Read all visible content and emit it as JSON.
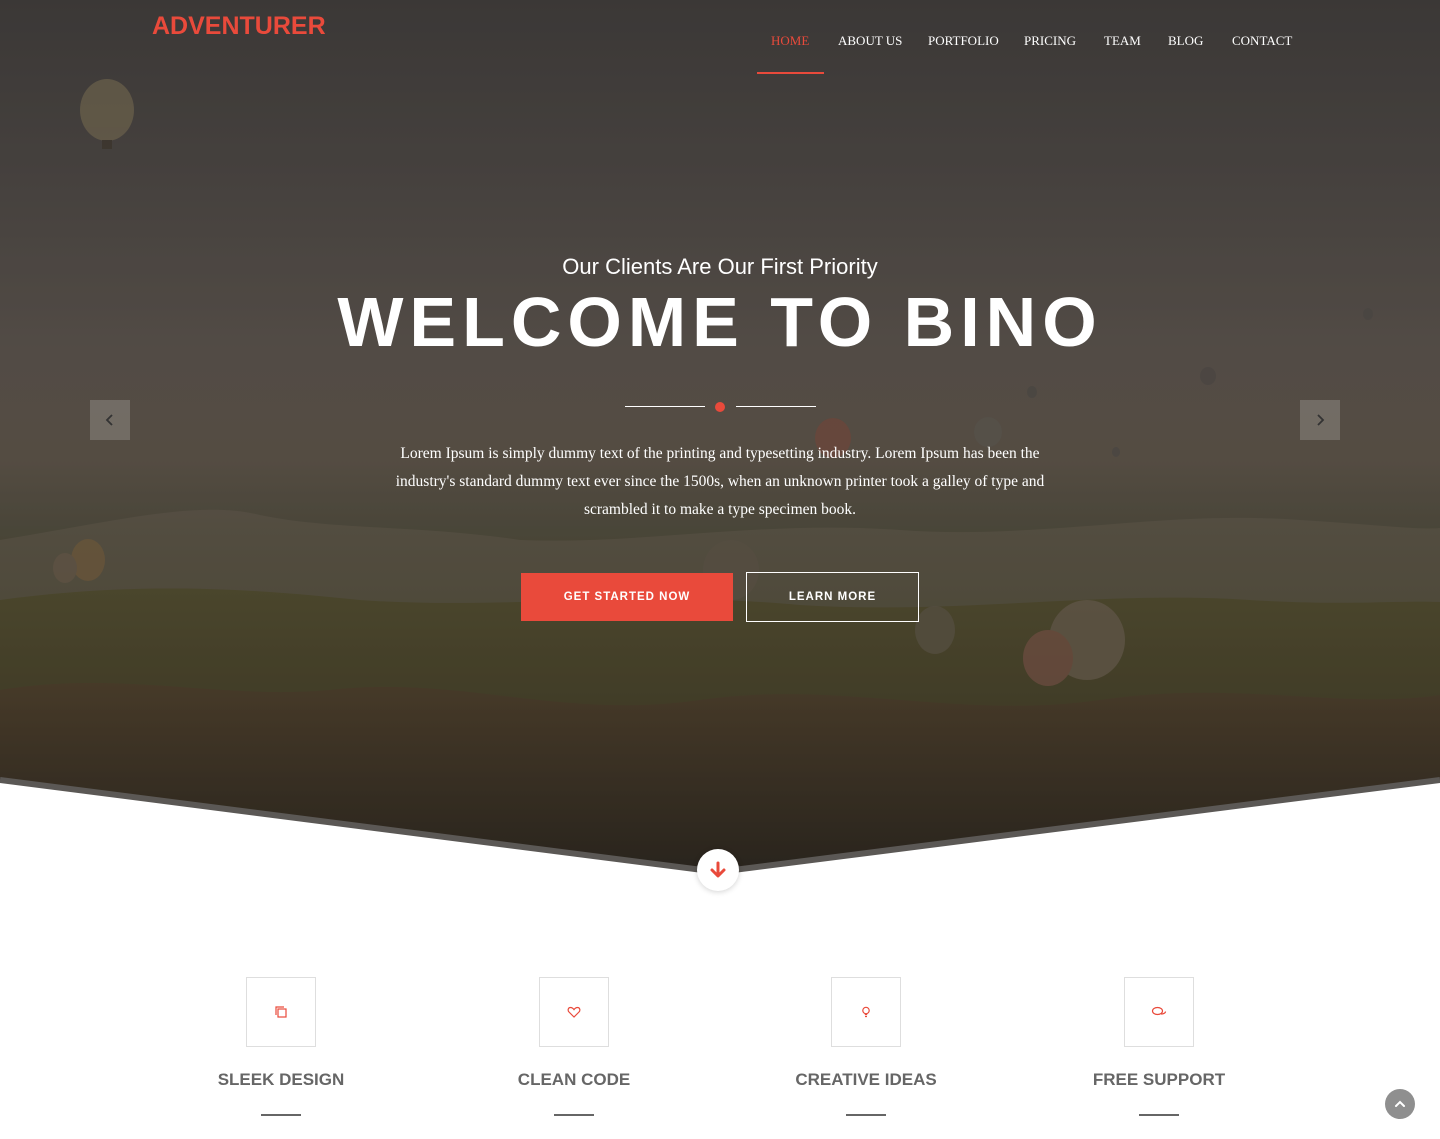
{
  "brand": {
    "logo_text": "ADVENTURER",
    "accent_color": "#e94a3b"
  },
  "nav": {
    "items": [
      {
        "label": "HOME",
        "active": true
      },
      {
        "label": "ABOUT US",
        "active": false
      },
      {
        "label": "PORTFOLIO",
        "active": false
      },
      {
        "label": "PRICING",
        "active": false
      },
      {
        "label": "TEAM",
        "active": false
      },
      {
        "label": "BLOG",
        "active": false
      },
      {
        "label": "CONTACT",
        "active": false
      }
    ]
  },
  "hero": {
    "subtitle": "Our Clients Are Our First Priority",
    "title": "WELCOME TO BINO",
    "description": "Lorem Ipsum is simply dummy text of the printing and typesetting industry. Lorem Ipsum has been the industry's standard dummy text ever since the 1500s, when an unknown printer took a galley of type and scrambled it to make a type specimen book.",
    "primary_button": "GET STARTED NOW",
    "secondary_button": "LEARN MORE",
    "prev_icon": "chevron-left-icon",
    "next_icon": "chevron-right-icon",
    "scroll_icon": "arrow-down-icon"
  },
  "features": [
    {
      "title": "SLEEK DESIGN",
      "icon": "copy-icon"
    },
    {
      "title": "CLEAN CODE",
      "icon": "heart-icon"
    },
    {
      "title": "CREATIVE IDEAS",
      "icon": "lightbulb-icon"
    },
    {
      "title": "FREE SUPPORT",
      "icon": "comments-icon"
    }
  ],
  "back_to_top_icon": "chevron-up-icon"
}
